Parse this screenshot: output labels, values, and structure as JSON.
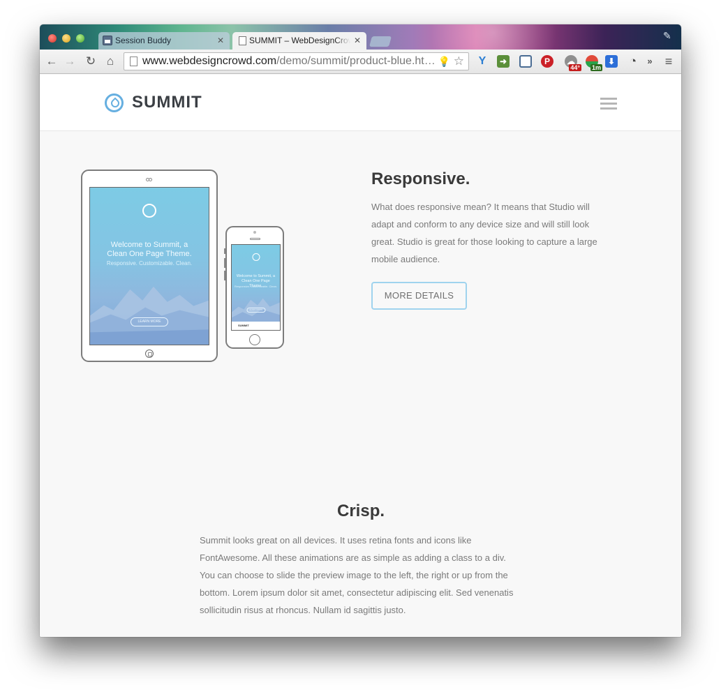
{
  "browser": {
    "tabs": [
      {
        "label": "Session Buddy",
        "active": false
      },
      {
        "label": "SUMMIT – WebDesignCrowd",
        "active": true
      }
    ],
    "url_host": "www.webdesigncrowd.com",
    "url_path": "/demo/summit/product-blue.ht…",
    "extension_badges": {
      "weather": "44°",
      "timer": "1m"
    }
  },
  "site": {
    "logo_text": "SUMMIT",
    "colors": {
      "accent": "#66afe0",
      "button_border": "#9fd3ee",
      "text": "#7a7a7a",
      "heading": "#3a3a3a"
    }
  },
  "devices": {
    "tablet_title": "Welcome to Summit, a Clean One Page Theme.",
    "tablet_sub": "Responsive. Customizable. Clean.",
    "tablet_button": "LEARN MORE",
    "phone_title": "Welcome to Summit, a Clean One Page Theme.",
    "phone_sub": "Responsive. Customizable. Clean.",
    "phone_button": "LEARN MORE",
    "phone_bar": "SUMMIT"
  },
  "responsive": {
    "title": "Responsive.",
    "body": "What does responsive mean? It means that Studio will adapt and conform to any device size and will still look great. Studio is great for those looking to capture a large mobile audience.",
    "button": "MORE DETAILS"
  },
  "crisp": {
    "title": "Crisp.",
    "body": "Summit looks great on all devices. It uses retina fonts and icons like FontAwesome. All these animations are as simple as adding a class to a div. You can choose to slide the preview image to the left, the right or up from the bottom. Lorem ipsum dolor sit amet, consectetur adipiscing elit. Sed venenatis sollicitudin risus at rhoncus. Nullam id sagittis justo."
  }
}
